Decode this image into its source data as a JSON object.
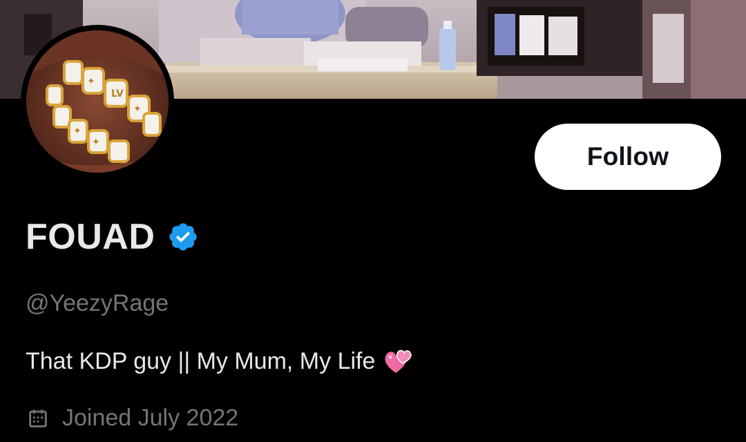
{
  "profile": {
    "display_name": "FOUAD",
    "handle": "@YeezyRage",
    "bio": "That KDP guy || My Mum, My Life",
    "bio_emoji": "two-hearts-icon",
    "joined": "Joined July 2022",
    "verified": true
  },
  "actions": {
    "follow_label": "Follow"
  },
  "colors": {
    "background": "#000000",
    "primary_text": "#e7e9ea",
    "secondary_text": "#71767b",
    "verified_blue": "#1d9bf0",
    "button_bg": "#ffffff",
    "button_text": "#0f1419"
  },
  "icons": {
    "verified": "verified-badge-icon",
    "calendar": "calendar-icon"
  }
}
